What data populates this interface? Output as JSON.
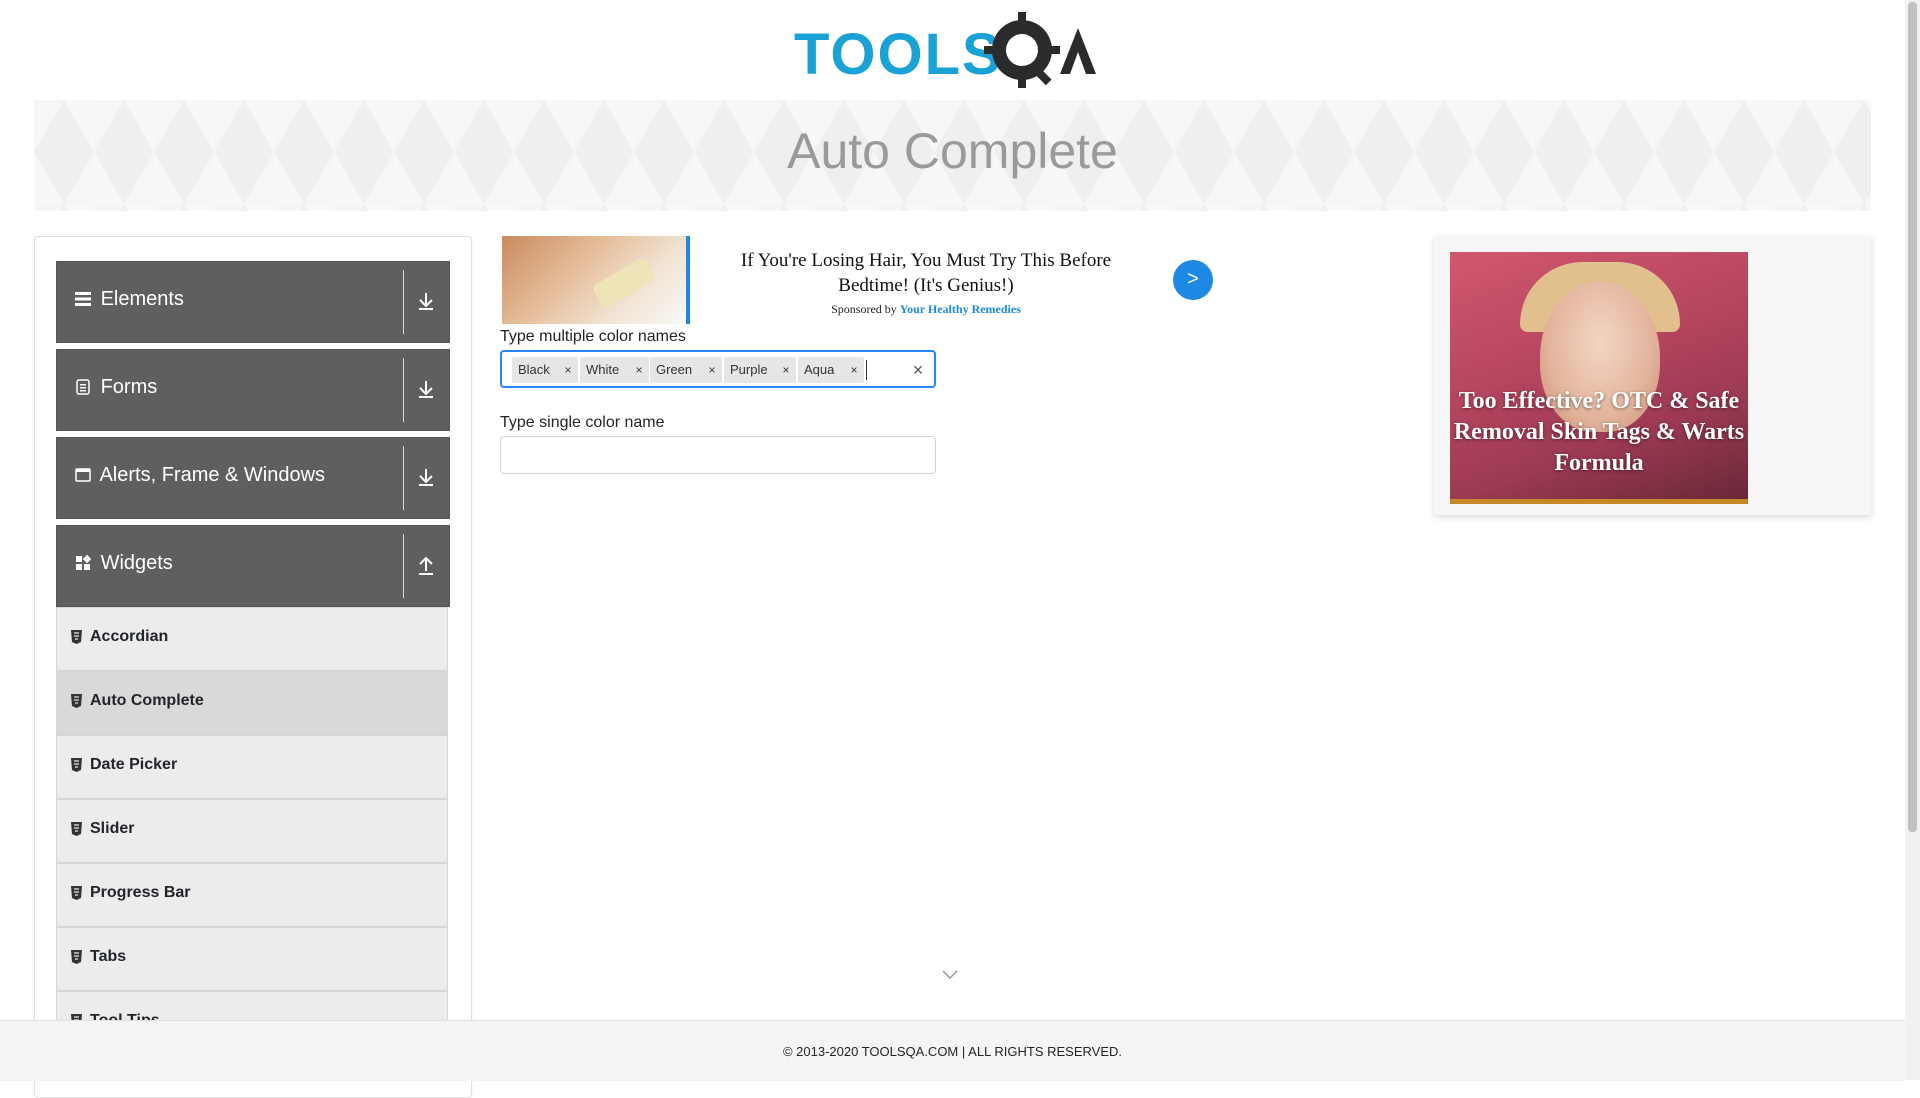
{
  "header": {
    "logo_text": "TOOLSQA"
  },
  "banner": {
    "title": "Auto Complete"
  },
  "sidebar": {
    "groups": [
      {
        "label": "Elements",
        "icon": "hamburger-icon",
        "expanded": false
      },
      {
        "label": "Forms",
        "icon": "document-icon",
        "expanded": false
      },
      {
        "label": "Alerts, Frame & Windows",
        "icon": "window-icon",
        "expanded": false
      },
      {
        "label": "Widgets",
        "icon": "widgets-icon",
        "expanded": true
      }
    ],
    "items": [
      {
        "label": "Accordian",
        "active": false
      },
      {
        "label": "Auto Complete",
        "active": true
      },
      {
        "label": "Date Picker",
        "active": false
      },
      {
        "label": "Slider",
        "active": false
      },
      {
        "label": "Progress Bar",
        "active": false
      },
      {
        "label": "Tabs",
        "active": false
      },
      {
        "label": "Tool Tips",
        "active": false
      }
    ]
  },
  "ad_top": {
    "headline": "If You're Losing Hair, You Must Try This Before Bedtime! (It's Genius!)",
    "sponsored_prefix": "Sponsored by",
    "sponsor": "Your Healthy Remedies",
    "arrow": ">"
  },
  "form": {
    "multi_label": "Type multiple color names",
    "multi_values": [
      "Black",
      "White",
      "Green",
      "Purple",
      "Aqua"
    ],
    "chip_remove": "×",
    "clear": "×",
    "single_label": "Type single color name",
    "single_value": ""
  },
  "ad_right": {
    "text": "Too Effective? OTC & Safe Removal Skin Tags & Warts Formula"
  },
  "footer": {
    "text": "© 2013-2020 TOOLSQA.COM | ALL RIGHTS RESERVED."
  },
  "colors": {
    "focus_border": "#2684ff",
    "ad_accent": "#1e88e5",
    "sidebar_group": "#5f5f5f"
  }
}
